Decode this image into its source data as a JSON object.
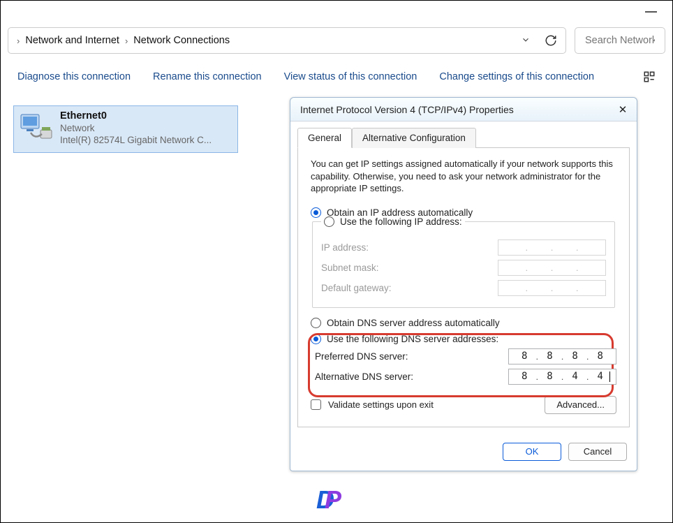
{
  "titlebar": {
    "minimize": "−"
  },
  "addressbar": {
    "crumb1": "Network and Internet",
    "crumb2": "Network Connections",
    "down_label": "▾",
    "refresh_label": "↻"
  },
  "search": {
    "placeholder": "Search Network Con"
  },
  "toolbar": {
    "diagnose": "Diagnose this connection",
    "rename": "Rename this connection",
    "view_status": "View status of this connection",
    "change_settings": "Change settings of this connection"
  },
  "adapter": {
    "name": "Ethernet0",
    "status": "Network",
    "device": "Intel(R) 82574L Gigabit Network C..."
  },
  "dialog": {
    "title": "Internet Protocol Version 4 (TCP/IPv4) Properties",
    "tab_general": "General",
    "tab_alt": "Alternative Configuration",
    "description": "You can get IP settings assigned automatically if your network supports this capability. Otherwise, you need to ask your network administrator for the appropriate IP settings.",
    "ip_auto": "Obtain an IP address automatically",
    "ip_manual": "Use the following IP address:",
    "ip_address_label": "IP address:",
    "subnet_label": "Subnet mask:",
    "gateway_label": "Default gateway:",
    "dns_auto": "Obtain DNS server address automatically",
    "dns_manual": "Use the following DNS server addresses:",
    "preferred_dns_label": "Preferred DNS server:",
    "alternative_dns_label": "Alternative DNS server:",
    "preferred_dns": {
      "o1": "8",
      "o2": "8",
      "o3": "8",
      "o4": "8"
    },
    "alternative_dns": {
      "o1": "8",
      "o2": "8",
      "o3": "4",
      "o4": "4"
    },
    "validate": "Validate settings upon exit",
    "advanced": "Advanced...",
    "ok": "OK",
    "cancel": "Cancel"
  }
}
